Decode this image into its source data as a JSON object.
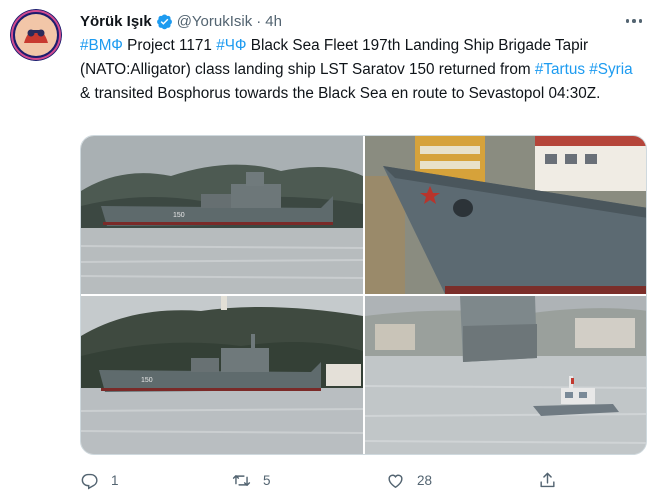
{
  "tweet": {
    "display_name": "Yörük Işık",
    "handle": "@YorukIsik",
    "separator": "·",
    "time": "4h",
    "text_parts": [
      {
        "text": "#ВМФ",
        "tag": true
      },
      {
        "text": " Project 1171 ",
        "tag": false
      },
      {
        "text": "#ЧФ",
        "tag": true
      },
      {
        "text": " Black Sea Fleet 197th Landing Ship Brigade Tapir (NATO:Alligator) class landing ship LST Saratov 150 returned from ",
        "tag": false
      },
      {
        "text": "#Tartus",
        "tag": true
      },
      {
        "text": " ",
        "tag": false
      },
      {
        "text": "#Syria",
        "tag": true
      },
      {
        "text": " & transited Bosphorus towards the Black Sea en route to Sevastopol 04:30Z.",
        "tag": false
      }
    ],
    "hull_number": "150",
    "stats": {
      "replies": "1",
      "retweets": "5",
      "likes": "28"
    }
  },
  "colors": {
    "link": "#1d9bf0",
    "verified": "#1d9bf0",
    "secondary_text": "#536471"
  },
  "icons": [
    "verified-badge-icon",
    "more-options-icon",
    "reply-icon",
    "retweet-icon",
    "like-icon",
    "share-icon"
  ]
}
